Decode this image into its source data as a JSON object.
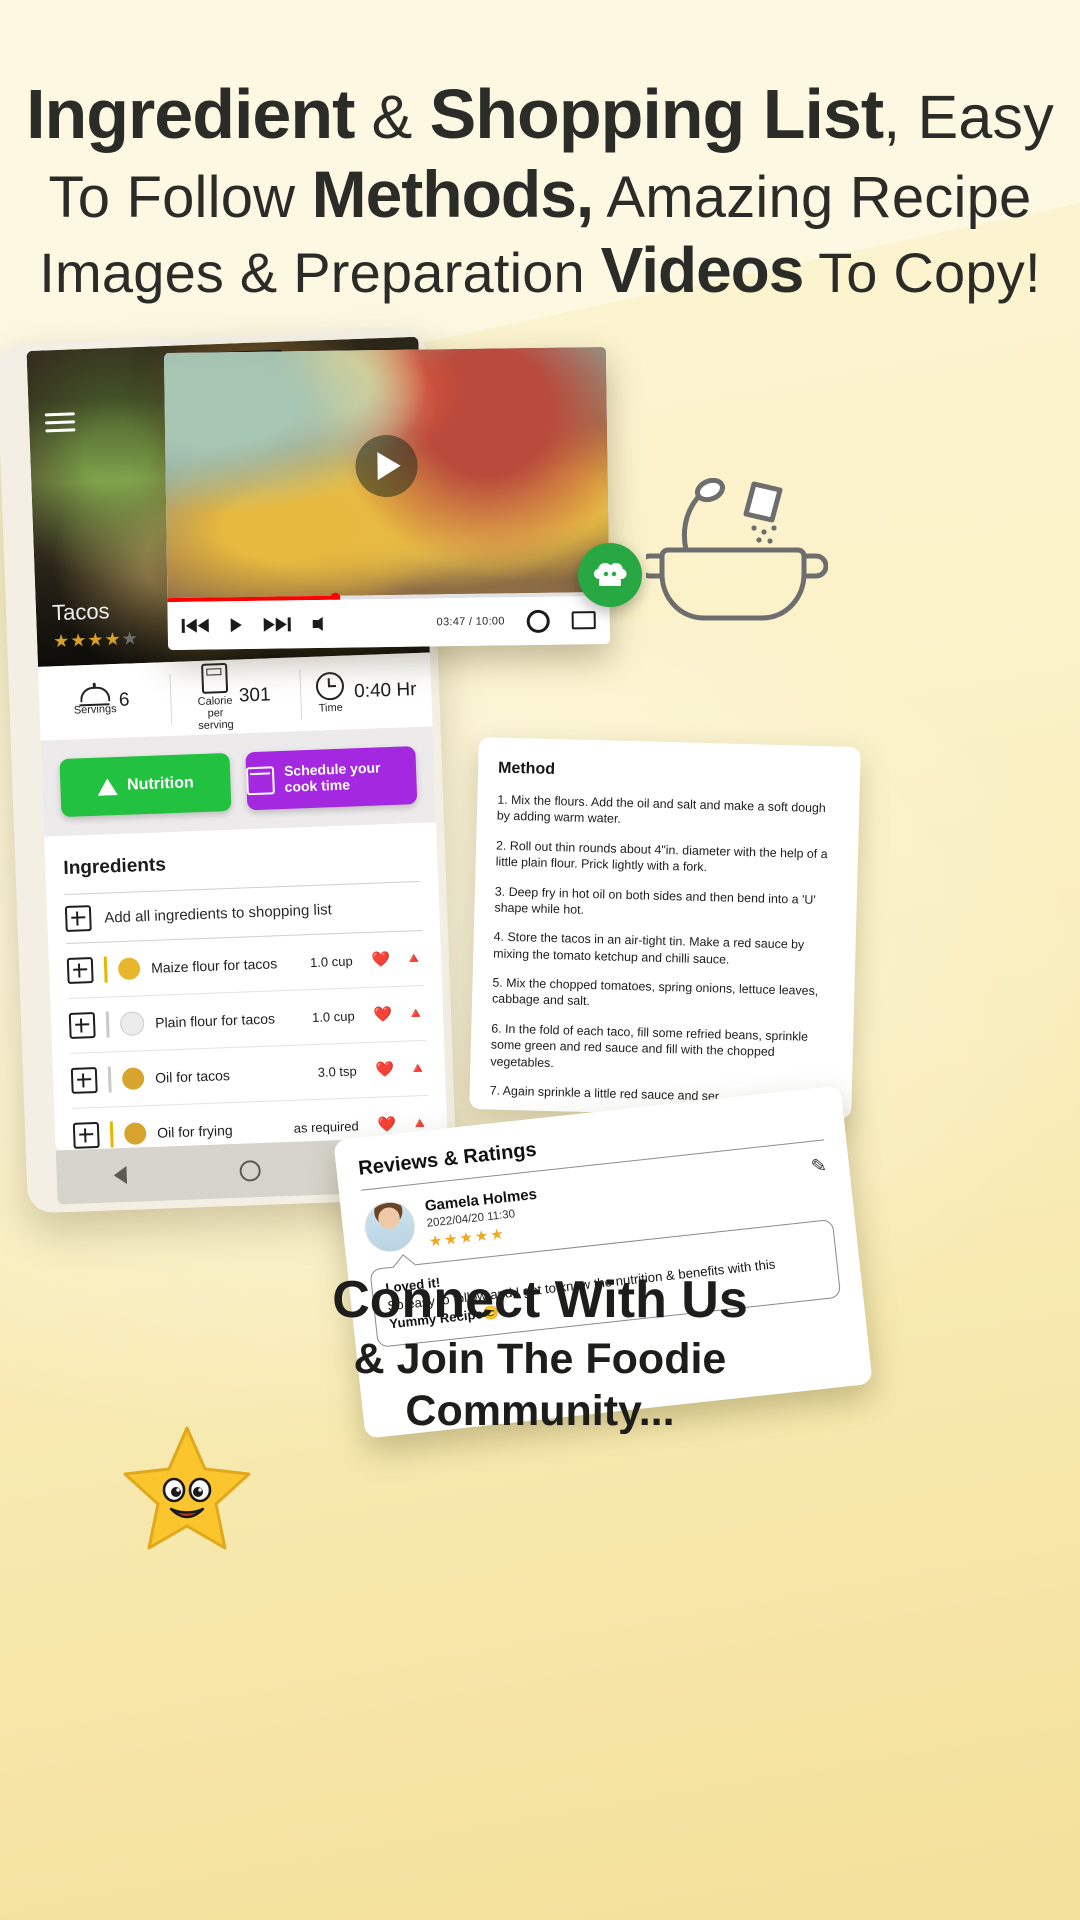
{
  "headline": {
    "line1": [
      {
        "text": "Ingredient",
        "weight": "bold"
      },
      {
        "text": " & ",
        "weight": "light"
      },
      {
        "text": "Shopping List",
        "weight": "bold"
      },
      {
        "text": ", Easy",
        "weight": "light"
      }
    ],
    "line2": [
      {
        "text": "To Follow ",
        "weight": "light"
      },
      {
        "text": "Methods,",
        "weight": "bold"
      },
      {
        "text": " Amazing Recipe",
        "weight": "light"
      }
    ],
    "line3": [
      {
        "text": "Images & Preparation ",
        "weight": "light"
      },
      {
        "text": "Videos",
        "weight": "bold"
      },
      {
        "text": " To Copy!",
        "weight": "light"
      }
    ]
  },
  "app": {
    "hero": {
      "title": "Tacos",
      "rating_filled": 4,
      "rating_total": 5,
      "menu_icon": "hamburger-menu-icon"
    },
    "stats": [
      {
        "icon": "serving-dome-icon",
        "label": "Servings",
        "value": "6"
      },
      {
        "icon": "calorie-calculator-icon",
        "label": "Calorie per serving",
        "value": "301"
      },
      {
        "icon": "clock-icon",
        "label": "Time",
        "value": "0:40 Hr"
      }
    ],
    "buttons": {
      "nutrition": {
        "label": "Nutrition",
        "icon": "pyramid-icon",
        "color": "#22c13f"
      },
      "schedule": {
        "label": "Schedule your cook time",
        "icon": "calendar-icon",
        "color": "#a428e0"
      }
    },
    "ingredients": {
      "heading": "Ingredients",
      "add_all_label": "Add all ingredients to shopping list",
      "items": [
        {
          "name": "Maize flour for tacos",
          "qty": "1.0 cup",
          "swatch": "#e8b62c",
          "bar": "#e8b600"
        },
        {
          "name": "Plain flour for tacos",
          "qty": "1.0 cup",
          "swatch": "#e8e8e8",
          "bar": "#c9c9c9"
        },
        {
          "name": "Oil for tacos",
          "qty": "3.0 tsp",
          "swatch": "#d7a52e",
          "bar": "#c9c9c9"
        },
        {
          "name": "Oil for frying",
          "qty": "as required",
          "swatch": "#d7a52e",
          "bar": "#e8b600"
        }
      ],
      "row_icons": [
        "heart-health-icon",
        "food-pyramid-icon"
      ]
    },
    "navbar": [
      "back-triangle-icon",
      "home-circle-icon",
      "recents-square-icon"
    ]
  },
  "video": {
    "current_time": "03:47",
    "duration": "10:00",
    "time_display": "03:47 / 10:00",
    "progress_percent": 38,
    "controls": [
      "previous-icon",
      "play-icon",
      "next-icon",
      "volume-icon",
      "settings-gear-icon",
      "fullscreen-icon"
    ],
    "play_overlay_icon": "play-overlay-icon",
    "accent": "#ff0000"
  },
  "badge": {
    "icon": "chef-hat-badge-icon",
    "color": "#27a842"
  },
  "pot": {
    "icon": "cooking-pot-with-salt-icon"
  },
  "method": {
    "heading": "Method",
    "steps": [
      "1. Mix the flours. Add the oil and salt and make a soft dough by adding warm water.",
      "2. Roll out thin rounds about 4\"in. diameter with the help of a little plain flour. Prick lightly with a fork.",
      "3. Deep fry in hot oil on both sides and then bend into a 'U' shape while hot.",
      "4. Store the tacos in an air-tight tin. Make a red sauce by mixing the tomato ketchup and chilli sauce.",
      "5. Mix the chopped tomatoes, spring onions, lettuce leaves, cabbage and salt.",
      "6. In the fold of each taco, fill some refried beans, sprinkle some green and red sauce and fill with the chopped vegetables.",
      "7. Again sprinkle a little red sauce and ser..."
    ]
  },
  "reviews": {
    "heading": "Reviews & Ratings",
    "reviewer_name": "Gamela Holmes",
    "date": "2022/04/20 11:30",
    "stars_filled": 5,
    "edit_icon": "pencil-edit-icon",
    "avatar_icon": "avatar",
    "comment_title": "Loved it!",
    "comment_body_1": "So easy to follow and I get to know the",
    "comment_body_2": "nutrition & benefits with this ",
    "comment_highlight": "Yummy Recipe",
    "comment_emoji": "😊"
  },
  "bottom": {
    "line1": "Connect With Us",
    "line2": "& Join The Foodie",
    "line3": "Community...",
    "mascot_icon": "smiling-star-mascot-icon"
  }
}
